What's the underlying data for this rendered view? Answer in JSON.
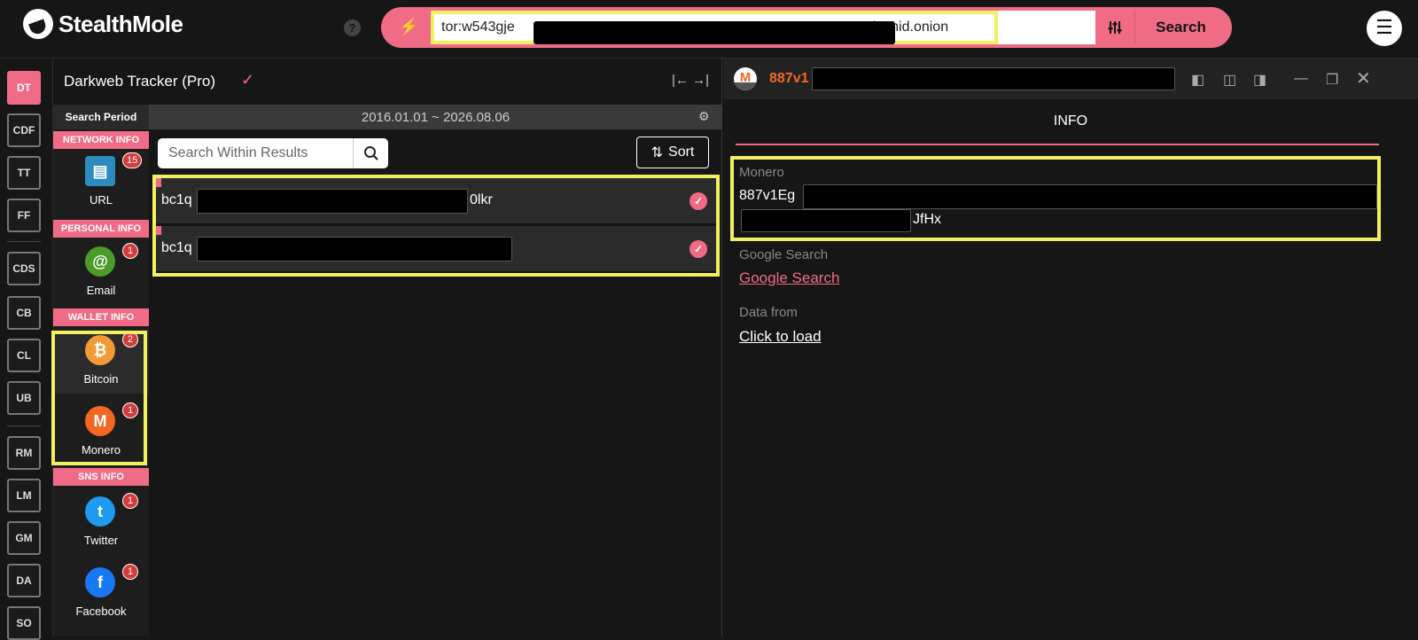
{
  "app": {
    "name": "StealthMole"
  },
  "colors": {
    "accent": "#f06b86",
    "highlight": "#f0f060",
    "monero": "#f26822",
    "bitcoin": "#f29a38",
    "twitter": "#1d9bf0",
    "facebook": "#1877f2",
    "url_icon": "#2e8bc0",
    "email_icon": "#4c9a2a",
    "badge": "#d43c3c"
  },
  "topbar": {
    "help_label": "?",
    "query_visible_prefix": "tor:w543gje",
    "query_visible_suffix": "kcmid.onion",
    "search_label": "Search",
    "filter_icon": "sliders-icon",
    "menu_icon": "hamburger-icon"
  },
  "rail": {
    "items": [
      "DT",
      "CDF",
      "TT",
      "FF",
      "CDS",
      "CB",
      "CL",
      "UB",
      "RM",
      "LM",
      "GM",
      "DA",
      "SO"
    ],
    "active": "DT"
  },
  "tracker": {
    "title": "Darkweb Tracker (Pro)",
    "search_period_label": "Search Period",
    "period": "2016.01.01 ~ 2026.08.06",
    "search_placeholder": "Search Within Results",
    "sort_label": "Sort",
    "categories": [
      {
        "header": "NETWORK INFO",
        "items": [
          {
            "label": "URL",
            "count": "15",
            "icon": "browser-window-icon"
          }
        ]
      },
      {
        "header": "PERSONAL INFO",
        "items": [
          {
            "label": "Email",
            "count": "1",
            "icon": "at-sign-icon"
          }
        ]
      },
      {
        "header": "WALLET INFO",
        "items": [
          {
            "label": "Bitcoin",
            "count": "2",
            "icon": "bitcoin-icon"
          },
          {
            "label": "Monero",
            "count": "1",
            "icon": "monero-icon"
          }
        ]
      },
      {
        "header": "SNS INFO",
        "items": [
          {
            "label": "Twitter",
            "count": "1",
            "icon": "twitter-icon"
          },
          {
            "label": "Facebook",
            "count": "1",
            "icon": "facebook-icon"
          }
        ]
      }
    ],
    "results": [
      {
        "prefix": "bc1q",
        "suffix": "0lkr"
      },
      {
        "prefix": "bc1q",
        "suffix": ""
      }
    ]
  },
  "detail": {
    "title_prefix": "887v1",
    "tab": "INFO",
    "fields": {
      "monero_label": "Monero",
      "monero_line1_prefix": "887v1Eg",
      "monero_line2_suffix": "JfHx",
      "google_label": "Google Search",
      "google_link": "Google Search",
      "data_from_label": "Data from",
      "data_from_link": "Click to load"
    }
  }
}
